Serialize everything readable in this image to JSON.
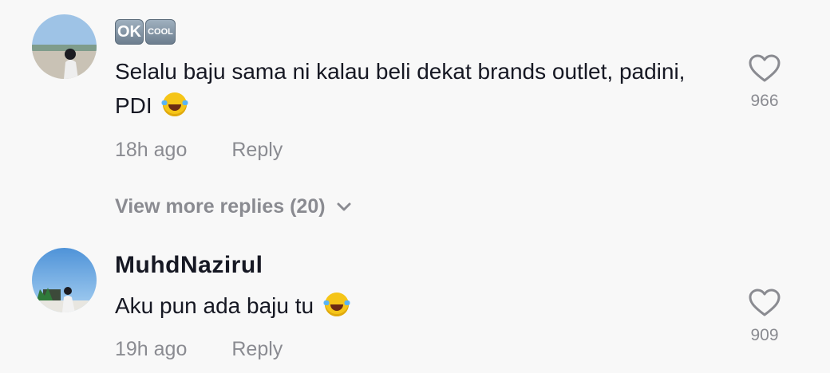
{
  "comments": [
    {
      "badges": [
        "OK",
        "COOL"
      ],
      "text": "Selalu baju sama ni kalau beli dekat brands outlet, padini, PDI",
      "emoji": "face-with-tears-of-joy-icon",
      "time": "18h ago",
      "reply_label": "Reply",
      "likes": "966"
    },
    {
      "username": "MuhdNazirul",
      "text": "Aku pun ada baju tu",
      "emoji": "face-with-tears-of-joy-icon",
      "time": "19h ago",
      "reply_label": "Reply",
      "likes": "909"
    }
  ],
  "view_more_label": "View more replies (20)",
  "colors": {
    "background": "#f8f8f8",
    "primary_text": "#161823",
    "secondary_text": "#8a8b91"
  }
}
